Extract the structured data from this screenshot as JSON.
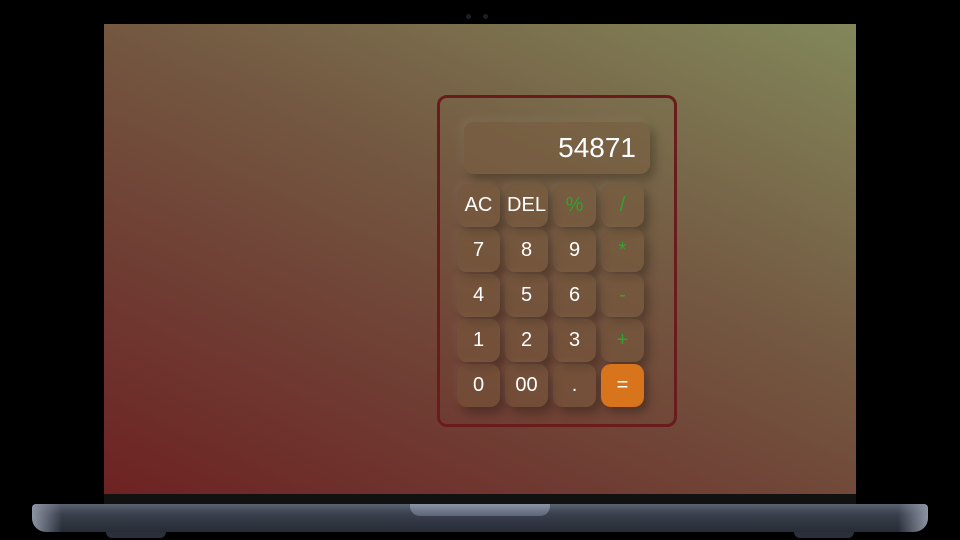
{
  "calculator": {
    "display_value": "54871",
    "keys": {
      "ac": "AC",
      "del": "DEL",
      "percent": "%",
      "divide": "/",
      "seven": "7",
      "eight": "8",
      "nine": "9",
      "multiply": "*",
      "four": "4",
      "five": "5",
      "six": "6",
      "minus": "-",
      "one": "1",
      "two": "2",
      "three": "3",
      "plus": "+",
      "zero": "0",
      "double_zero": "00",
      "decimal": ".",
      "equals": "="
    }
  },
  "colors": {
    "operator_text": "#2ea52e",
    "equals_background": "#d7741c",
    "frame_border": "#6a1c1c"
  }
}
